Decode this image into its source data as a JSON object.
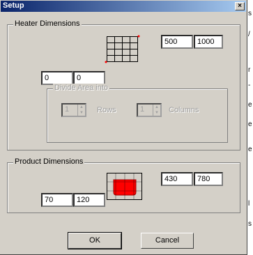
{
  "window": {
    "title": "Setup",
    "close_glyph": "×"
  },
  "edge_chars": [
    "s",
    "/",
    "r",
    "-",
    "e",
    "e",
    "e",
    "l",
    "s"
  ],
  "heater": {
    "group_label": "Heater Dimensions",
    "value_left_1": "0",
    "value_left_2": "0",
    "value_right_1": "500",
    "value_right_2": "1000",
    "divide": {
      "group_label": "Divide Area into",
      "rows_value": "1",
      "rows_label": "Rows",
      "columns_value": "1",
      "columns_label": "Columns"
    }
  },
  "product": {
    "group_label": "Product Dimensions",
    "value_left_1": "70",
    "value_left_2": "120",
    "value_right_1": "430",
    "value_right_2": "780"
  },
  "buttons": {
    "ok": "OK",
    "cancel": "Cancel"
  },
  "colors": {
    "title_start": "#0a246a",
    "title_end": "#a6caf0",
    "product_fill": "#ff0000",
    "marker": "#ff0000"
  }
}
